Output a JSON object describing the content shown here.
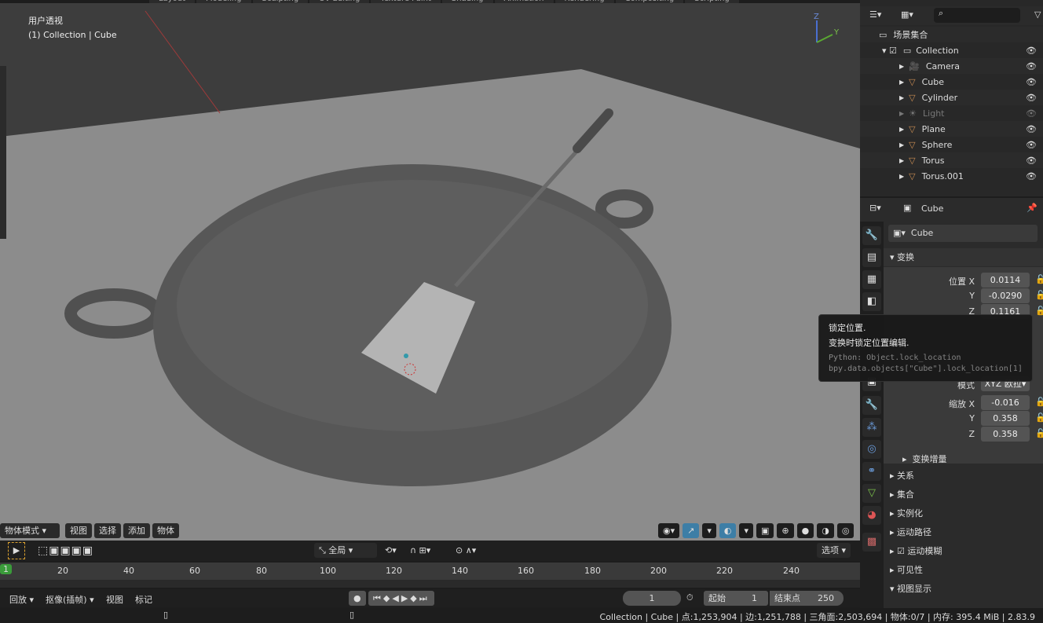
{
  "workspace_tabs": [
    "Layout",
    "Modeling",
    "Sculpting",
    "UV Editing",
    "Texture Paint",
    "Shading",
    "Animation",
    "Rendering",
    "Compositing",
    "Scripting"
  ],
  "viewport": {
    "title": "用户透视",
    "subtitle": "(1) Collection | Cube",
    "mode": "物体模式",
    "menus": [
      "视图",
      "选择",
      "添加",
      "物体"
    ]
  },
  "timeline": {
    "orientation": "全局",
    "options": "选项",
    "ruler": [
      "1",
      "20",
      "40",
      "60",
      "80",
      "100",
      "120",
      "140",
      "160",
      "180",
      "200",
      "220",
      "240"
    ],
    "menus": {
      "playback": "回放",
      "keying": "抠像(插帧)",
      "view": "视图",
      "marker": "标记"
    },
    "current_frame": "1",
    "start_label": "起始",
    "start": "1",
    "end_label": "结束点",
    "end": "250"
  },
  "outliner": {
    "root": "场景集合",
    "collection": "Collection",
    "items": [
      {
        "name": "Camera",
        "icon": "camera-icon"
      },
      {
        "name": "Cube",
        "icon": "mesh-icon"
      },
      {
        "name": "Cylinder",
        "icon": "mesh-icon"
      },
      {
        "name": "Light",
        "icon": "light-icon"
      },
      {
        "name": "Plane",
        "icon": "mesh-icon"
      },
      {
        "name": "Sphere",
        "icon": "mesh-icon"
      },
      {
        "name": "Torus",
        "icon": "mesh-icon"
      },
      {
        "name": "Torus.001",
        "icon": "mesh-icon"
      }
    ]
  },
  "properties": {
    "header": "Cube",
    "object_name": "Cube",
    "transform": "变换",
    "location_label": "位置 X",
    "loc": [
      "0.0114",
      "-0.0290",
      "0.1161"
    ],
    "mode_label": "模式",
    "mode_value": "XYZ 欧拉",
    "scale_label": "缩放 X",
    "scale": [
      "-0.016",
      "0.358",
      "0.358"
    ],
    "y": "Y",
    "z": "Z",
    "delta": "变换增量",
    "panels": [
      "关系",
      "集合",
      "实例化",
      "运动路径",
      "运动模糊",
      "可见性",
      "视图显示"
    ]
  },
  "tooltip": {
    "title": "锁定位置.",
    "desc": "变换时锁定位置编辑.",
    "python": "Python: Object.lock_location",
    "path": "bpy.data.objects[\"Cube\"].lock_location[1]"
  },
  "status": "Collection | Cube | 点:1,253,904 | 边:1,251,788 | 三角面:2,503,694 | 物体:0/7  | 内存: 395.4 MiB | 2.83.9",
  "colors": {
    "accent": "#3d7ea6",
    "frame": "#3a9b3a",
    "mesh": "#c98c52"
  }
}
